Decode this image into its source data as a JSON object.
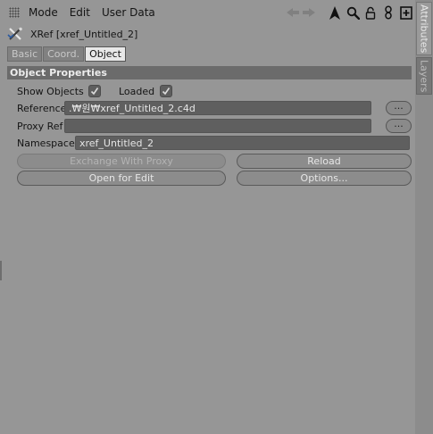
{
  "menu": {
    "items": [
      "Mode",
      "Edit",
      "User Data"
    ]
  },
  "toolbar": {
    "icons": [
      "back-forward-arrows-icon",
      "cursor-arrow-icon",
      "search-icon",
      "lock-icon",
      "link-icon",
      "new-panel-icon"
    ]
  },
  "object": {
    "title": "XRef [xref_Untitled_2]",
    "icon": "xref-icon"
  },
  "tabs": [
    {
      "label": "Basic",
      "active": false
    },
    {
      "label": "Coord.",
      "active": false
    },
    {
      "label": "Object",
      "active": true
    }
  ],
  "section": {
    "title": "Object Properties"
  },
  "fields": {
    "show_objects_label": "Show Objects",
    "loaded_label": "Loaded",
    "reference_label": "Reference",
    "reference_value": ".₩원₩xref_Untitled_2.c4d",
    "reference_browse": "...",
    "proxy_label": "Proxy Ref",
    "proxy_value": "",
    "proxy_browse": "...",
    "namespace_label": "Namespace",
    "namespace_value": "xref_Untitled_2"
  },
  "buttons": {
    "exchange": "Exchange With Proxy",
    "reload": "Reload",
    "open_edit": "Open for Edit",
    "options": "Options..."
  },
  "side_tabs": {
    "attributes": "Attributes",
    "layers": "Layers"
  }
}
